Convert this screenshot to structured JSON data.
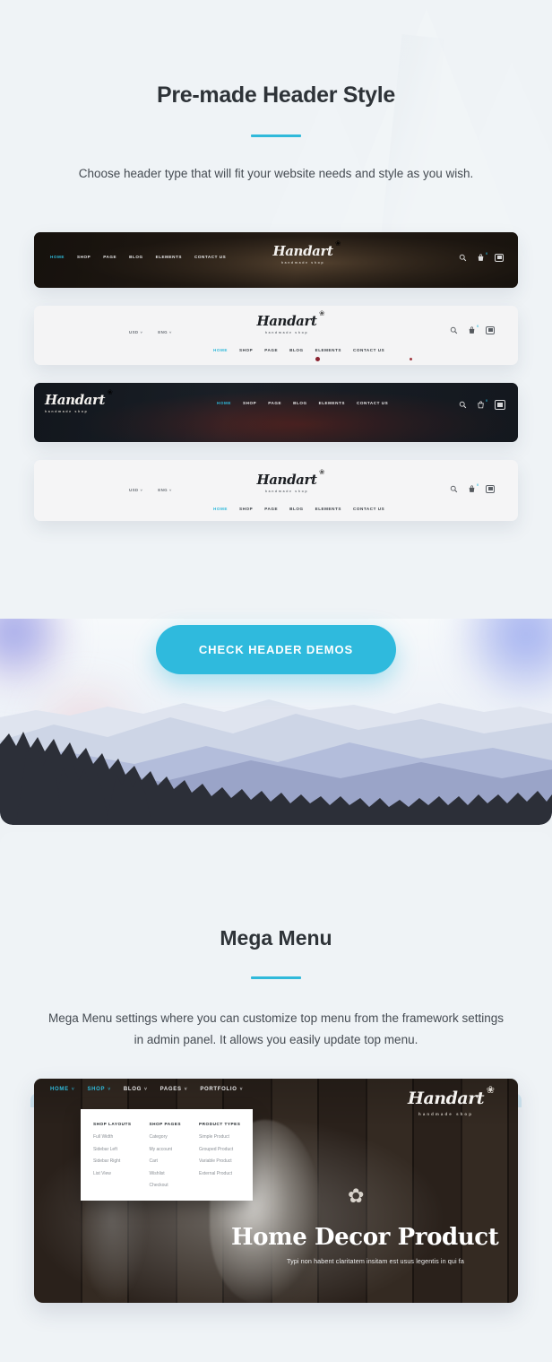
{
  "theme": {
    "accent": "#2fb9da",
    "page_bg": "#eff3f6",
    "heading_color": "#2e3338"
  },
  "section_one": {
    "title": "Pre-made Header Style",
    "subtitle": "Choose header type that will fit your website needs and style as you wish.",
    "cta_label": "CHECK HEADER DEMOS",
    "brand": {
      "word": "Handart",
      "tagline": "handmade shop",
      "sprig_icon": "floral-sprig-icon"
    },
    "menu": [
      "HOME",
      "SHOP",
      "PAGE",
      "BLOG",
      "ELEMENTS",
      "CONTACT US"
    ],
    "language_bar": {
      "currency": "USD",
      "currency_caret": "˅",
      "language": "ENG",
      "language_caret": "˅"
    },
    "icons": {
      "search": "search-icon",
      "cart": "cart-icon",
      "cart_badge": "0",
      "menu": "hamburger-menu-icon"
    },
    "header_variants": [
      {
        "name": "dark-centered-logo-header",
        "style": "dark"
      },
      {
        "name": "light-stacked-header",
        "style": "light"
      },
      {
        "name": "dark-left-logo-header",
        "style": "dark"
      },
      {
        "name": "light-stacked-header-alt",
        "style": "light"
      }
    ]
  },
  "section_two": {
    "title": "Mega Menu",
    "subtitle": "Mega Menu settings where you can customize top menu from the framework settings in admin panel.  It allows you easily update top menu.",
    "brand": {
      "word": "Handart",
      "tagline": "handmade shop",
      "sprig_icon": "floral-sprig-icon"
    },
    "nav": [
      {
        "label": "HOME",
        "caret": "˅",
        "active": true
      },
      {
        "label": "SHOP",
        "caret": "˅",
        "active": true
      },
      {
        "label": "BLOG",
        "caret": "˅",
        "active": false
      },
      {
        "label": "PAGES",
        "caret": "˅",
        "active": false
      },
      {
        "label": "PORTFOLIO",
        "caret": "˅",
        "active": false
      }
    ],
    "dropdown": {
      "columns": [
        {
          "heading": "SHOP LAYOUTS",
          "items": [
            "Full Width",
            "Sidebar Left",
            "Sidebar Right",
            "List View"
          ]
        },
        {
          "heading": "SHOP PAGES",
          "items": [
            "Category",
            "My account",
            "Cart",
            "Wishlist",
            "Checkout"
          ]
        },
        {
          "heading": "PRODUCT TYPES",
          "items": [
            "Simple Product",
            "Grouped Product",
            "Variable Product",
            "External Product"
          ]
        }
      ]
    },
    "hero": {
      "title": "Home Decor Product",
      "text": "Typi non habent claritatem insitam est usus legentis in qui fa",
      "sprig_icon": "leaf-sprig-icon"
    }
  }
}
